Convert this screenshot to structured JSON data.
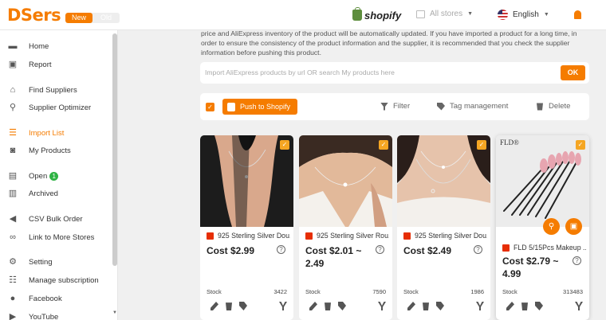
{
  "brand": {
    "logo": "DSers",
    "version_new": "New",
    "version_old": "Old",
    "accent": "#f57c00"
  },
  "header": {
    "platform": "shopify",
    "stores": "All stores",
    "language": "English"
  },
  "sidebar": {
    "items": [
      {
        "label": "Home",
        "icon": "home-icon"
      },
      {
        "label": "Report",
        "icon": "report-icon"
      },
      {
        "label": "Find Suppliers",
        "icon": "find-suppliers-icon"
      },
      {
        "label": "Supplier Optimizer",
        "icon": "search-icon"
      },
      {
        "label": "Import List",
        "icon": "import-list-icon",
        "active": true
      },
      {
        "label": "My Products",
        "icon": "bag-icon"
      },
      {
        "label": "Open",
        "icon": "clipboard-icon",
        "badge": "1"
      },
      {
        "label": "Archived",
        "icon": "archive-icon"
      },
      {
        "label": "CSV Bulk Order",
        "icon": "megaphone-icon"
      },
      {
        "label": "Link to More Stores",
        "icon": "link-icon"
      },
      {
        "label": "Setting",
        "icon": "gear-icon"
      },
      {
        "label": "Manage subscription",
        "icon": "sliders-icon"
      },
      {
        "label": "Facebook",
        "icon": "facebook-icon"
      },
      {
        "label": "YouTube",
        "icon": "youtube-icon"
      }
    ]
  },
  "main": {
    "notice": "price and AliExpress inventory of the product will be automatically updated. If you have imported a product for a long time, in order to ensure the consistency of the product information and the supplier, it is recommended that you check the supplier information before pushing this product.",
    "import_placeholder": "Import AliExpress products by url OR search My products here",
    "ok_label": "OK",
    "push_label": "Push to Shopify",
    "filter_label": "Filter",
    "tag_label": "Tag management",
    "delete_label": "Delete",
    "stock_label": "Stock",
    "products": [
      {
        "title": "925 Sterling Silver Dou...",
        "price": "Cost $2.99",
        "stock": "3422",
        "image_label": ""
      },
      {
        "title": "925 Sterling Silver Rou...",
        "price": "Cost $2.01 ~ 2.49",
        "stock": "7590",
        "image_label": ""
      },
      {
        "title": "925 Sterling Silver Dou...",
        "price": "Cost $2.49",
        "stock": "1986",
        "image_label": ""
      },
      {
        "title": "FLD 5/15Pcs Makeup ...",
        "price": "Cost $2.79 ~ 4.99",
        "stock": "313483",
        "image_label": "FLD®"
      }
    ]
  }
}
